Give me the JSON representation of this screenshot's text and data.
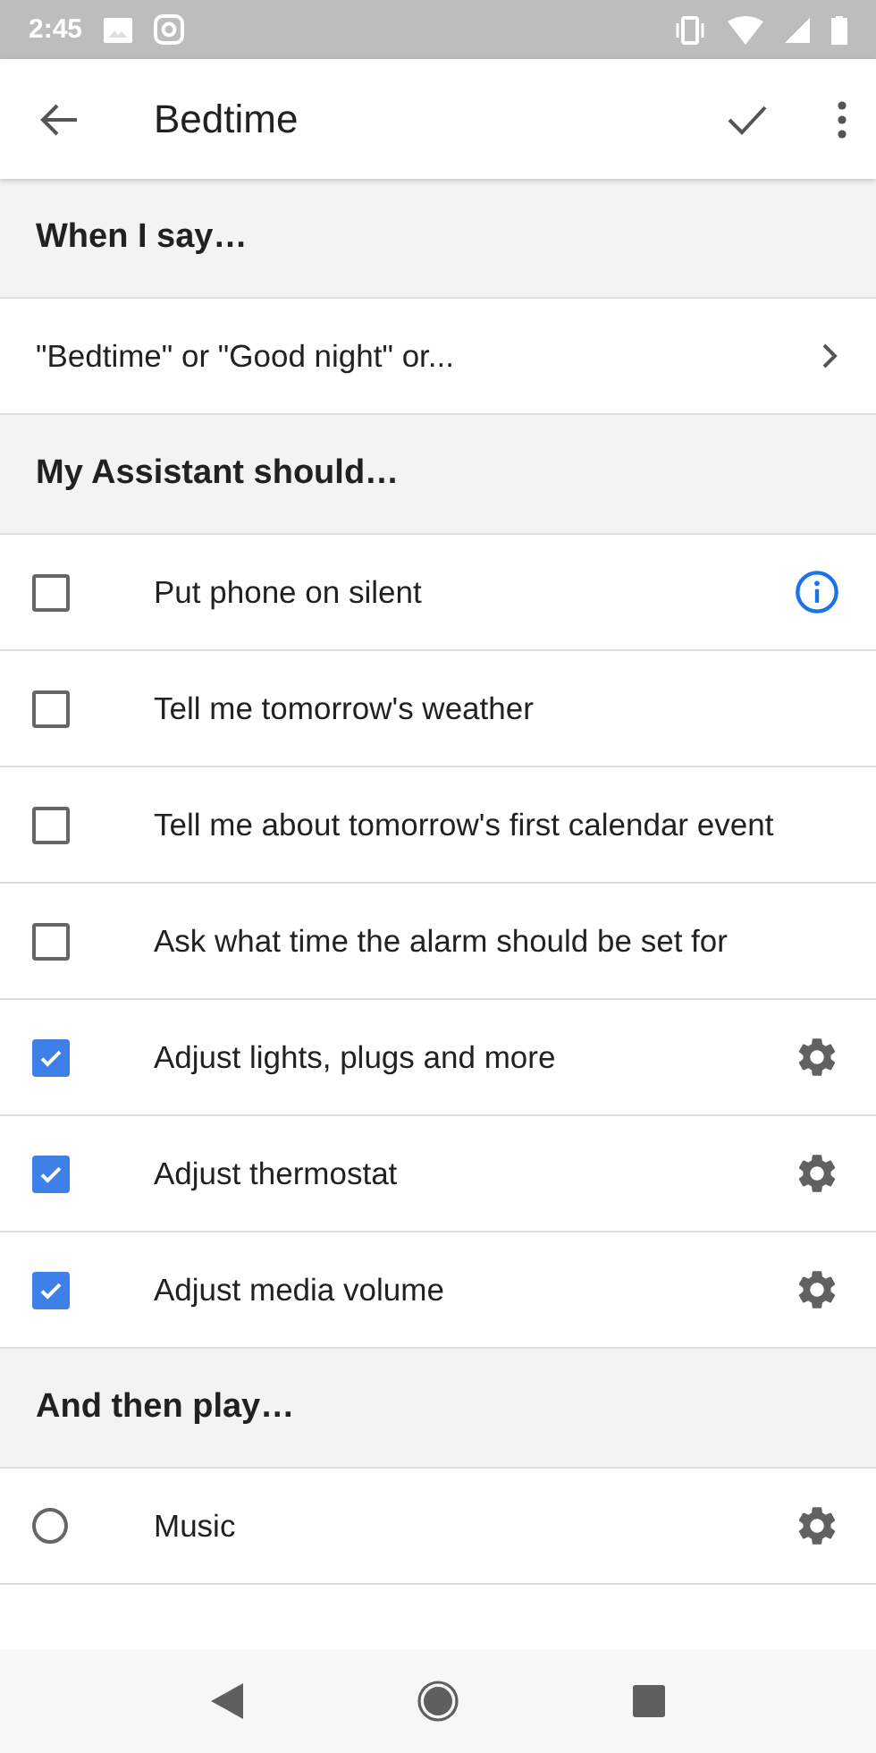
{
  "status_bar": {
    "time": "2:45"
  },
  "app_bar": {
    "title": "Bedtime"
  },
  "sections": [
    {
      "header": "When I say…",
      "rows": [
        {
          "kind": "link",
          "label": "\"Bedtime\" or \"Good night\" or..."
        }
      ]
    },
    {
      "header": "My Assistant should…",
      "rows": [
        {
          "kind": "checkbox",
          "label": "Put phone on silent",
          "checked": false,
          "has_info": true
        },
        {
          "kind": "checkbox",
          "label": "Tell me tomorrow's weather",
          "checked": false
        },
        {
          "kind": "checkbox",
          "label": "Tell me about tomorrow's first calendar event",
          "checked": false
        },
        {
          "kind": "checkbox",
          "label": "Ask what time the alarm should be set for",
          "checked": false
        },
        {
          "kind": "checkbox",
          "label": "Adjust lights, plugs and more",
          "checked": true,
          "has_settings": true
        },
        {
          "kind": "checkbox",
          "label": "Adjust thermostat",
          "checked": true,
          "has_settings": true
        },
        {
          "kind": "checkbox",
          "label": "Adjust media volume",
          "checked": true,
          "has_settings": true
        }
      ]
    },
    {
      "header": "And then play…",
      "rows": [
        {
          "kind": "radio",
          "label": "Music",
          "selected": false,
          "has_settings": true
        }
      ]
    }
  ]
}
